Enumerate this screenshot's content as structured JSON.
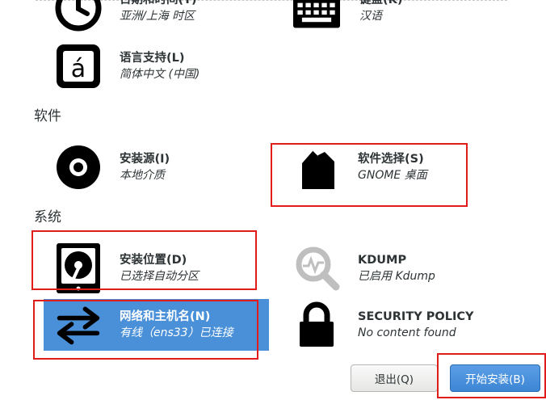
{
  "localization": {
    "spokes": [
      {
        "title": "日期和时间(T)",
        "status": "亚洲/上海 时区",
        "icon": "clock-icon"
      },
      {
        "title": "键盘(K)",
        "status": "汉语",
        "icon": "keyboard-icon"
      },
      {
        "title": "语言支持(L)",
        "status": "简体中文 (中国)",
        "icon": "language-icon"
      }
    ]
  },
  "software": {
    "heading": "软件",
    "spokes": [
      {
        "title": "安装源(I)",
        "status": "本地介质",
        "icon": "disc-icon"
      },
      {
        "title": "软件选择(S)",
        "status": "GNOME 桌面",
        "icon": "package-icon"
      }
    ]
  },
  "system": {
    "heading": "系统",
    "spokes": [
      {
        "title": "安装位置(D)",
        "status": "已选择自动分区",
        "icon": "hard-disk-icon"
      },
      {
        "title": "KDUMP",
        "status": "已启用 Kdump",
        "icon": "search-icon"
      },
      {
        "title": "网络和主机名(N)",
        "status": "有线（ens33）已连接",
        "icon": "network-arrows-icon",
        "selected": true
      },
      {
        "title": "SECURITY POLICY",
        "status": "No content found",
        "icon": "lock-icon"
      }
    ]
  },
  "buttons": {
    "quit": "退出(Q)",
    "begin_install": "开始安装(B)"
  },
  "colors": {
    "selected_background": "#4a90d9",
    "primary_button": "#3d86d4",
    "annotation_red": "#e21b1b",
    "icon": "#000000",
    "icon_disabled": "#bfbfbf"
  }
}
